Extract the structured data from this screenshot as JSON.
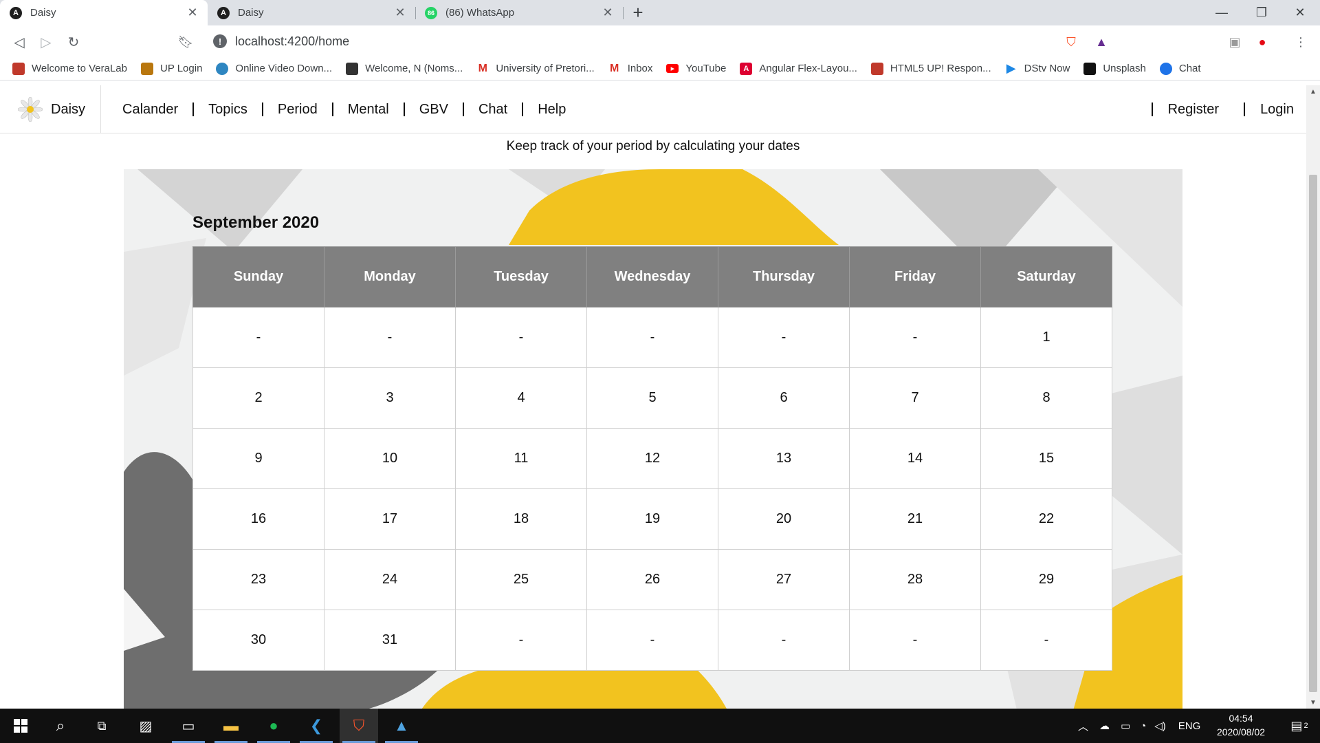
{
  "browser": {
    "tabs": [
      {
        "label": "Daisy",
        "icon": "angular-icon",
        "active": true
      },
      {
        "label": "Daisy",
        "icon": "angular-icon",
        "active": false
      },
      {
        "label": "(86) WhatsApp",
        "icon": "whatsapp-icon",
        "badge": "86",
        "active": false
      }
    ],
    "url": "localhost:4200/home",
    "bookmarks": [
      {
        "label": "Welcome to VeraLab",
        "color": "#c0392b"
      },
      {
        "label": "UP Login",
        "color": "#b9770e"
      },
      {
        "label": "Online Video Down...",
        "color": "#2e86c1"
      },
      {
        "label": "Welcome, N (Noms...",
        "color": "#333333"
      },
      {
        "label": "University of Pretori...",
        "color": "#d93025"
      },
      {
        "label": "Inbox",
        "color": "#d93025"
      },
      {
        "label": "YouTube",
        "color": "#ff0000"
      },
      {
        "label": "Angular Flex-Layou...",
        "color": "#dd0031"
      },
      {
        "label": "HTML5 UP! Respon...",
        "color": "#c0392b"
      },
      {
        "label": "DStv Now",
        "color": "#1e88e5"
      },
      {
        "label": "Unsplash",
        "color": "#111111"
      },
      {
        "label": "Chat",
        "color": "#1e73e8"
      }
    ]
  },
  "app": {
    "brand": "Daisy",
    "nav": [
      "Calander",
      "Topics",
      "Period",
      "Mental",
      "GBV",
      "Chat",
      "Help"
    ],
    "nav_right": [
      "Register",
      "Login"
    ],
    "subtitle": "Keep track of your period by calculating your dates",
    "calendar": {
      "title": "September 2020",
      "weekdays": [
        "Sunday",
        "Monday",
        "Tuesday",
        "Wednesday",
        "Thursday",
        "Friday",
        "Saturday"
      ],
      "weeks": [
        [
          "-",
          "-",
          "-",
          "-",
          "-",
          "-",
          "1"
        ],
        [
          "2",
          "3",
          "4",
          "5",
          "6",
          "7",
          "8"
        ],
        [
          "9",
          "10",
          "11",
          "12",
          "13",
          "14",
          "15"
        ],
        [
          "16",
          "17",
          "18",
          "19",
          "20",
          "21",
          "22"
        ],
        [
          "23",
          "24",
          "25",
          "26",
          "27",
          "28",
          "29"
        ],
        [
          "30",
          "31",
          "-",
          "-",
          "-",
          "-",
          "-"
        ]
      ]
    }
  },
  "taskbar": {
    "language": "ENG",
    "time": "04:54",
    "date": "2020/08/02",
    "notifications": "2"
  },
  "colors": {
    "header_cell": "#808080",
    "petal_yellow": "#f2c31f",
    "petal_gray": "#6e6e6e"
  }
}
